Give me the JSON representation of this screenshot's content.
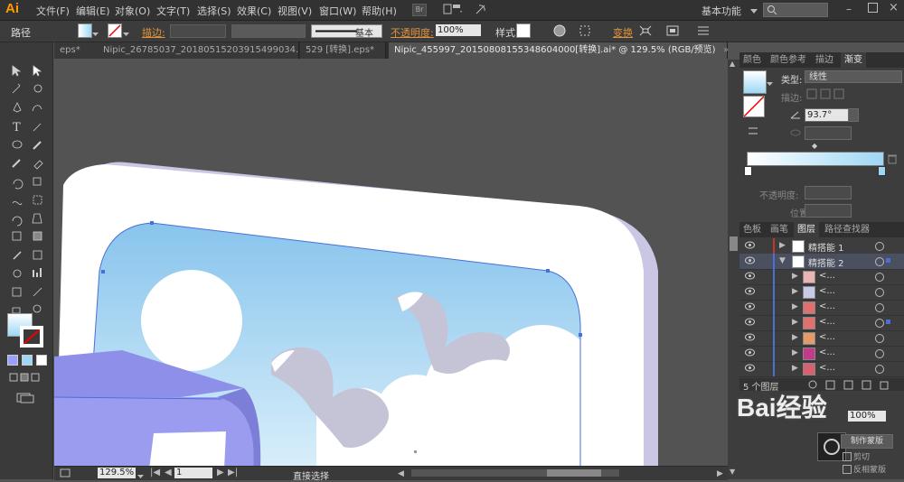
{
  "menubar": {
    "logo": "Ai",
    "menus": [
      "文件(F)",
      "编辑(E)",
      "对象(O)",
      "文字(T)",
      "选择(S)",
      "效果(C)",
      "视图(V)",
      "窗口(W)",
      "帮助(H)"
    ],
    "workspace": "基本功能",
    "br_label": "Br"
  },
  "control": {
    "path_label": "路径",
    "stroke_label": "描边:",
    "stroke_style": "基本",
    "opacity_label": "不透明度:",
    "opacity_value": "100%",
    "style_label": "样式:",
    "transform_label": "变换"
  },
  "tabs": [
    "eps*",
    "Nipic_26785037_20180515203915499034.ai*",
    "529 [转换].eps*",
    "Nipic_455997_20150808155348604000[转换].ai* @ 129.5% (RGB/预览)"
  ],
  "status": {
    "zoom": "129.5%",
    "page": "1",
    "tool": "直接选择"
  },
  "panel_tabs_top": [
    "颜色",
    "颜色参考",
    "描边",
    "渐变"
  ],
  "gradient": {
    "type_label": "类型:",
    "type_value": "线性",
    "stroke_label": "描边:",
    "angle_value": "93.7°",
    "opacity_label": "不透明度:",
    "position_label": "位置:",
    "start_color": "#ffffff",
    "end_color": "#9dd7f5"
  },
  "panel_tabs_layers": [
    "色板",
    "画笔",
    "图层",
    "路径查找器"
  ],
  "layers": [
    {
      "name": "精搭能 1",
      "expanded": false,
      "level": 0,
      "color": "#c0392b"
    },
    {
      "name": "精搭能 2",
      "expanded": true,
      "level": 0,
      "color": "#4a6fd6",
      "selected": true
    },
    {
      "name": "<...",
      "level": 1,
      "thumb": "#e8b4b4"
    },
    {
      "name": "<...",
      "level": 1,
      "thumb": "#c9c9e8"
    },
    {
      "name": "<...",
      "level": 1,
      "thumb": "#e07070"
    },
    {
      "name": "<...",
      "level": 1,
      "thumb": "#e07070",
      "selected_mark": true
    },
    {
      "name": "<...",
      "level": 1,
      "thumb": "#e69a6a"
    },
    {
      "name": "<...",
      "level": 1,
      "thumb": "#c23a8a"
    },
    {
      "name": "<...",
      "level": 1,
      "thumb": "#d86070"
    }
  ],
  "layers_footer": "5 个图层",
  "bottom_panel": {
    "opacity_value": "100%",
    "make_mask": "制作蒙版",
    "clip": "剪切",
    "invert": "反相蒙版"
  },
  "watermark": "Bai经验",
  "colors": {
    "sky_top": "#8cc8ee",
    "sky_bottom": "#d8eefa",
    "frame": "#ffffff",
    "shadow": "#c9c7e4",
    "bird": "#c5c3d6",
    "box": "#8e8fe8",
    "selection": "#4a6fd6"
  }
}
